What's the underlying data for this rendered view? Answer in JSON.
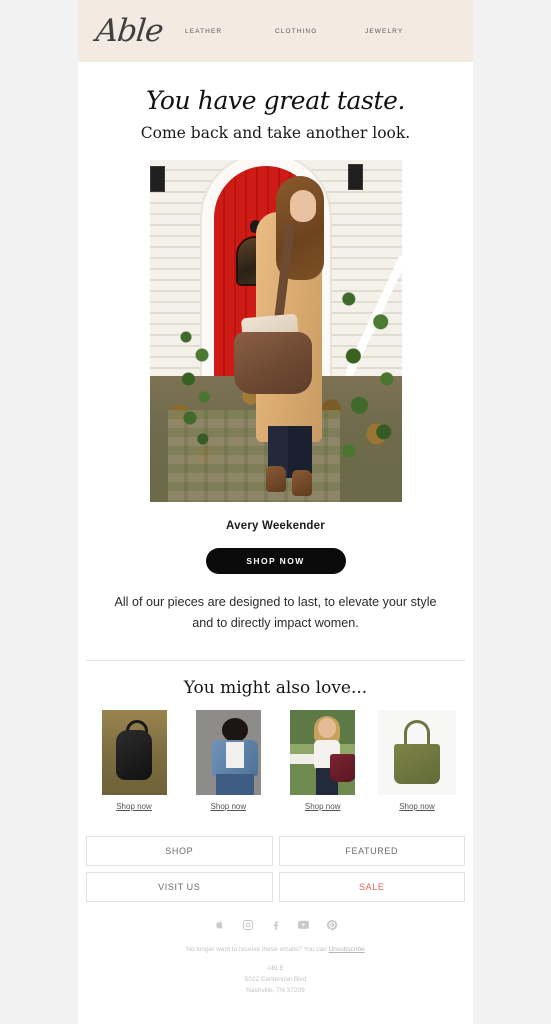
{
  "header": {
    "logo": "Able",
    "nav": [
      {
        "label": "LEATHER"
      },
      {
        "label": "CLOTHING"
      },
      {
        "label": "JEWELRY"
      }
    ]
  },
  "hero": {
    "headline": "You have great taste.",
    "subheadline": "Come back and take another look.",
    "image_alt": "Woman in camel coat with brown leather weekender bag in front of red arched door"
  },
  "product": {
    "title": "Avery Weekender",
    "cta_label": "SHOP NOW"
  },
  "body_copy": "All of our pieces are designed to last, to elevate your style and to directly impact women.",
  "recommendations": {
    "title": "You might also love...",
    "items": [
      {
        "link_label": "Shop now",
        "image_alt": "black leather backpack on autumn leaves"
      },
      {
        "link_label": "Shop now",
        "image_alt": "model wearing denim jacket"
      },
      {
        "link_label": "Shop now",
        "image_alt": "model with burgundy leather tote outdoors"
      },
      {
        "link_label": "Shop now",
        "image_alt": "olive green leather tote bag"
      }
    ]
  },
  "link_buttons": [
    {
      "label": "SHOP"
    },
    {
      "label": "FEATURED"
    },
    {
      "label": "VISIT US"
    },
    {
      "label": "SALE"
    }
  ],
  "social": [
    {
      "name": "apple-icon"
    },
    {
      "name": "instagram-icon"
    },
    {
      "name": "facebook-icon"
    },
    {
      "name": "youtube-icon"
    },
    {
      "name": "pinterest-icon"
    }
  ],
  "footer": {
    "unsubscribe_text": "No longer want to receive these emails? You can ",
    "unsubscribe_link": "Unsubscribe",
    "company": "ABLE",
    "street": "5022 Centennial Blvd",
    "city_state_zip": "Nashville, TN 37209"
  },
  "colors": {
    "header_bg": "#f3eae1",
    "cta_bg": "#0b0b0b",
    "sale_text": "#e2635c",
    "page_bg": "#f2f2f2"
  }
}
